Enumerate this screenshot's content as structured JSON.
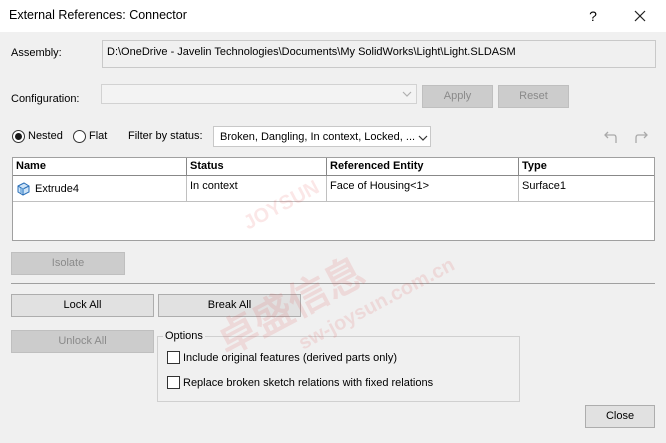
{
  "window": {
    "title": "External References: Connector",
    "help_label": "?"
  },
  "assembly": {
    "label": "Assembly:",
    "path": "D:\\OneDrive - Javelin Technologies\\Documents\\My SolidWorks\\Light\\Light.SLDASM"
  },
  "configuration": {
    "label": "Configuration:",
    "value": "",
    "apply_label": "Apply",
    "reset_label": "Reset"
  },
  "view_mode": {
    "nested_label": "Nested",
    "flat_label": "Flat",
    "selected": "Nested"
  },
  "filter": {
    "label": "Filter by status:",
    "value": "Broken, Dangling, In context, Locked, ..."
  },
  "table": {
    "columns": [
      "Name",
      "Status",
      "Referenced Entity",
      "Type"
    ],
    "rows": [
      {
        "name": "Extrude4",
        "status": "In context",
        "entity": "Face of Housing<1>",
        "type": "Surface1"
      }
    ]
  },
  "buttons": {
    "isolate": "Isolate",
    "lock_all": "Lock All",
    "break_all": "Break All",
    "unlock_all": "Unlock All",
    "close": "Close"
  },
  "options": {
    "title": "Options",
    "include_original": "Include original features (derived parts only)",
    "replace_broken": "Replace broken sketch relations with fixed relations",
    "include_original_checked": false,
    "replace_broken_checked": false
  },
  "watermark": {
    "text_cn": "卓盛信息",
    "text_url": "sw-joysun.com.cn",
    "text_brand": "JOYSUN"
  },
  "colors": {
    "accent_blue": "#2a6fb8",
    "watermark_red": "#dc3c3c"
  }
}
